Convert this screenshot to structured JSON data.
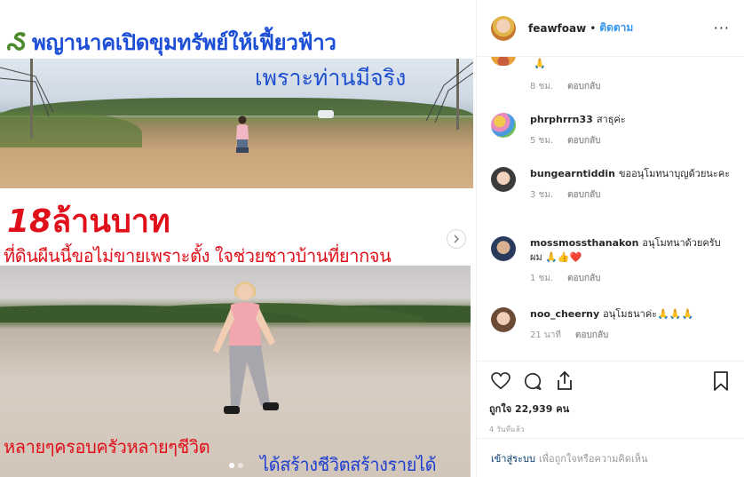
{
  "media": {
    "caption_top": "พญานาคเปิดขุมทรัพย์ให้เฟี้ยวฟ้าว",
    "caption_sub": "เพราะท่านมีจริง",
    "price_number": "18",
    "price_text": "ล้านบาท",
    "red_line": "ที่ดินผืนนี้ขอไม่ขายเพราะตั้ง ใจช่วยชาวบ้านที่ยากจน",
    "bottom_left": "หลายๆครอบครัวหลายๆชีวิต",
    "bottom_right": "ได้สร้างชีวิตสร้างรายได้",
    "next_icon": "chevron-right-icon",
    "carousel_dots": 2,
    "carousel_active": 1
  },
  "header": {
    "username": "feawfoaw",
    "separator": "•",
    "follow_label": "ติดตาม",
    "more_label": "···"
  },
  "comments": [
    {
      "username": "",
      "text": "🙏",
      "time": "8 ชม.",
      "reply": "ตอบกลับ"
    },
    {
      "username": "phrphrrn33",
      "text": "สาธุค่ะ",
      "time": "5 ชม.",
      "reply": "ตอบกลับ"
    },
    {
      "username": "bungearntiddin",
      "text": "ขออนุโมทนาบุญด้วยนะคะ",
      "time": "3 ชม.",
      "reply": "ตอบกลับ"
    },
    {
      "username": "mossmossthanakon",
      "text": "อนุโมทนาด้วยครับผม 🙏👍❤️",
      "time": "1 ชม.",
      "reply": "ตอบกลับ"
    },
    {
      "username": "noo_cheerny",
      "text": "อนุโมธนาค่ะ🙏🙏🙏",
      "time": "21 นาที",
      "reply": "ตอบกลับ"
    }
  ],
  "actions": {
    "likes": "ถูกใจ 22,939 คน",
    "time_ago": "4 วันที่แล้ว"
  },
  "add_comment": {
    "login_label": "เข้าสู่ระบบ",
    "rest": "เพื่อถูกใจหรือความคิดเห็น"
  },
  "colors": {
    "accent": "#3897f0",
    "caption_blue": "#1c4fd6",
    "caption_red": "#e0101a"
  }
}
